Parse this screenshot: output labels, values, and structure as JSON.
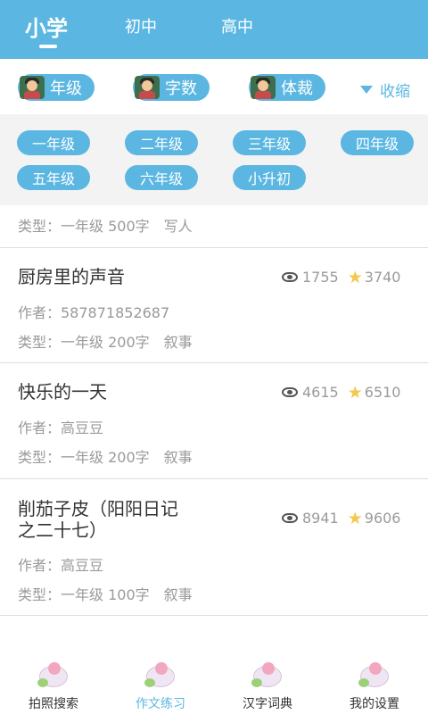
{
  "tabs": [
    {
      "label": "小学",
      "active": true
    },
    {
      "label": "初中",
      "active": false
    },
    {
      "label": "高中",
      "active": false
    }
  ],
  "filters": {
    "chips": [
      {
        "label": "年级",
        "icon": "student-avatar-icon"
      },
      {
        "label": "字数",
        "icon": "student-avatar-icon"
      },
      {
        "label": "体裁",
        "icon": "student-avatar-icon"
      }
    ],
    "collapse_label": "收缩"
  },
  "grades": [
    "一年级",
    "二年级",
    "三年级",
    "四年级",
    "五年级",
    "六年级",
    "小升初"
  ],
  "partial_item": {
    "meta_type": "类型：一年级 500字　写人"
  },
  "articles": [
    {
      "title": "厨房里的声音",
      "author": "作者：587871852687",
      "type": "类型：一年级 200字　叙事",
      "views": "1755",
      "stars": "3740"
    },
    {
      "title": "快乐的一天",
      "author": "作者：高豆豆",
      "type": "类型：一年级 200字　叙事",
      "views": "4615",
      "stars": "6510"
    },
    {
      "title_line1": "削茄子皮（阳阳日记",
      "title_line2": "之二十七）",
      "author": "作者：高豆豆",
      "type": "类型：一年级 100字　叙事",
      "views": "8941",
      "stars": "9606"
    }
  ],
  "bottom_nav": [
    {
      "label": "拍照搜索",
      "icon": "photo-search-icon",
      "active": false
    },
    {
      "label": "作文练习",
      "icon": "essay-practice-icon",
      "active": true
    },
    {
      "label": "汉字词典",
      "icon": "dictionary-icon",
      "active": false
    },
    {
      "label": "我的设置",
      "icon": "settings-icon",
      "active": false
    }
  ],
  "colors": {
    "accent": "#5bb7e2",
    "star": "#f2c94c",
    "meta": "#9a9a9a"
  }
}
